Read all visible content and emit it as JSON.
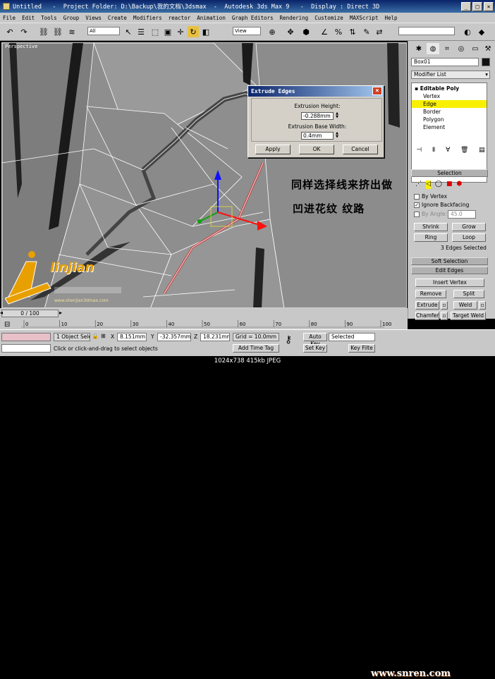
{
  "window": {
    "doc_name": "Untitled",
    "project_label": "Project Folder: D:\\Backup\\我的文档\\3dsmax",
    "app_name": "Autodesk 3ds Max 9",
    "display_mode": "Display : Direct 3D",
    "title_sep": "-"
  },
  "menu": [
    "File",
    "Edit",
    "Tools",
    "Group",
    "Views",
    "Create",
    "Modifiers",
    "reactor",
    "Animation",
    "Graph Editors",
    "Rendering",
    "Customize",
    "MAXScript",
    "Help"
  ],
  "toolbar": {
    "selection_filter": "All",
    "ref_coord": "View"
  },
  "viewport": {
    "label": "Perspective"
  },
  "dialog": {
    "title": "Extrude Edges",
    "height_label": "Extrusion Height:",
    "height_value": "-0.288mm",
    "width_label": "Extrusion Base Width:",
    "width_value": "0.4mm",
    "apply": "Apply",
    "ok": "OK",
    "cancel": "Cancel"
  },
  "annotation": {
    "line1": "同样选择线来挤出做",
    "line2": "凹进花纹 纹路"
  },
  "logo": {
    "brand": "linjian",
    "subtitle": "www.shenjian3dmax.com"
  },
  "panel": {
    "object_name": "Box01",
    "object_color": "#101010",
    "modifier_list": "Modifier List",
    "stack": [
      "Editable Poly",
      "Vertex",
      "Edge",
      "Border",
      "Polygon",
      "Element"
    ],
    "stack_selected_index": 2,
    "selection_title": "Selection",
    "by_vertex": "By Vertex",
    "ignore_backfacing": "Ignore Backfacing",
    "by_angle": "By Angle:",
    "by_angle_value": "45.0",
    "shrink": "Shrink",
    "grow": "Grow",
    "ring": "Ring",
    "loop": "Loop",
    "selection_status": "3 Edges Selected",
    "soft_selection": "Soft Selection",
    "edit_edges": "Edit Edges",
    "insert_vertex": "Insert Vertex",
    "remove": "Remove",
    "split": "Split",
    "extrude": "Extrude",
    "weld": "Weld",
    "chamfer": "Chamfer",
    "target_weld": "Target Weld",
    "bridge": "Bridge",
    "connect": "Connect"
  },
  "timeline": {
    "frame_display": "0 / 100",
    "ticks": [
      "0",
      "10",
      "20",
      "30",
      "40",
      "50",
      "60",
      "70",
      "80",
      "90",
      "100"
    ]
  },
  "status": {
    "selection_count": "1 Object Sele",
    "x_label": "X",
    "x": "8.151mm",
    "y_label": "Y",
    "y": "-32.357mm",
    "z_label": "Z",
    "z": "18.231mm",
    "grid": "Grid = 10.0mm",
    "prompt": "Click or click-and-drag to select objects",
    "add_time_tag": "Add Time Tag",
    "auto_key": "Auto Key",
    "key_mode": "Selected",
    "set_key": "Set Key",
    "key_filters": "Key Filte"
  },
  "caption": "1024x738  415kb  JPEG",
  "watermark": "www.snren.com"
}
